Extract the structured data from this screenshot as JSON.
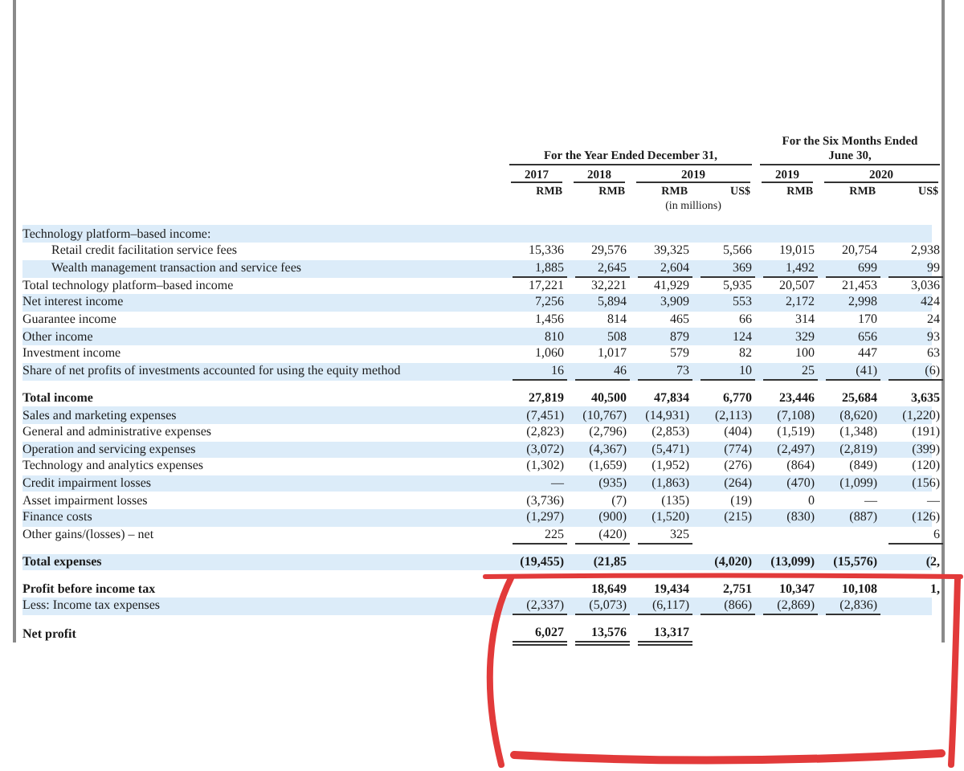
{
  "periods": [
    {
      "title": "For the Year Ended December 31,",
      "years": [
        {
          "label": "2017",
          "units": [
            "RMB"
          ]
        },
        {
          "label": "2018",
          "units": [
            "RMB"
          ]
        },
        {
          "label": "2019",
          "units": [
            "RMB",
            "US$"
          ]
        }
      ]
    },
    {
      "title": "For the Six Months Ended June 30,",
      "years": [
        {
          "label": "2019",
          "units": [
            "RMB"
          ]
        },
        {
          "label": "2020",
          "units": [
            "RMB",
            "US$"
          ]
        }
      ]
    }
  ],
  "note": "(in millions)",
  "rows": [
    {
      "label": "Technology platform–based income:",
      "kind": "section",
      "values": []
    },
    {
      "label": "Retail credit facilitation service fees",
      "kind": "indent",
      "values": [
        "15,336",
        "29,576",
        "39,325",
        "5,566",
        "19,015",
        "20,754",
        "2,938"
      ]
    },
    {
      "label": "Wealth management transaction and service fees",
      "kind": "indent",
      "underlined": true,
      "values": [
        "1,885",
        "2,645",
        "2,604",
        "369",
        "1,492",
        "699",
        "99"
      ]
    },
    {
      "label": "Total technology platform–based income",
      "kind": "item",
      "values": [
        "17,221",
        "32,221",
        "41,929",
        "5,935",
        "20,507",
        "21,453",
        "3,036"
      ]
    },
    {
      "label": "Net interest income",
      "kind": "item",
      "values": [
        "7,256",
        "5,894",
        "3,909",
        "553",
        "2,172",
        "2,998",
        "424"
      ]
    },
    {
      "label": "Guarantee income",
      "kind": "item",
      "values": [
        "1,456",
        "814",
        "465",
        "66",
        "314",
        "170",
        "24"
      ]
    },
    {
      "label": "Other income",
      "kind": "item",
      "values": [
        "810",
        "508",
        "879",
        "124",
        "329",
        "656",
        "93"
      ]
    },
    {
      "label": "Investment income",
      "kind": "item",
      "values": [
        "1,060",
        "1,017",
        "579",
        "82",
        "100",
        "447",
        "63"
      ]
    },
    {
      "label": "Share of net profits of investments accounted for using the equity method",
      "kind": "item",
      "underlined": true,
      "values": [
        "16",
        "46",
        "73",
        "10",
        "25",
        "(41)",
        "(6)"
      ]
    },
    {
      "label": "Total income",
      "kind": "total",
      "values": [
        "27,819",
        "40,500",
        "47,834",
        "6,770",
        "23,446",
        "25,684",
        "3,635"
      ]
    },
    {
      "label": "Sales and marketing expenses",
      "kind": "item",
      "values": [
        "(7,451)",
        "(10,767)",
        "(14,931)",
        "(2,113)",
        "(7,108)",
        "(8,620)",
        "(1,220)"
      ]
    },
    {
      "label": "General and administrative expenses",
      "kind": "item",
      "values": [
        "(2,823)",
        "(2,796)",
        "(2,853)",
        "(404)",
        "(1,519)",
        "(1,348)",
        "(191)"
      ]
    },
    {
      "label": "Operation and servicing expenses",
      "kind": "item",
      "values": [
        "(3,072)",
        "(4,367)",
        "(5,471)",
        "(774)",
        "(2,497)",
        "(2,819)",
        "(399)"
      ]
    },
    {
      "label": "Technology and analytics expenses",
      "kind": "item",
      "values": [
        "(1,302)",
        "(1,659)",
        "(1,952)",
        "(276)",
        "(864)",
        "(849)",
        "(120)"
      ]
    },
    {
      "label": "Credit impairment losses",
      "kind": "item",
      "values": [
        "—",
        "(935)",
        "(1,863)",
        "(264)",
        "(470)",
        "(1,099)",
        "(156)"
      ]
    },
    {
      "label": "Asset impairment losses",
      "kind": "item",
      "values": [
        "(3,736)",
        "(7)",
        "(135)",
        "(19)",
        "0",
        "—",
        "—"
      ]
    },
    {
      "label": "Finance costs",
      "kind": "item",
      "values": [
        "(1,297)",
        "(900)",
        "(1,520)",
        "(215)",
        "(830)",
        "(887)",
        "(126)"
      ]
    },
    {
      "label": "Other gains/(losses) – net",
      "kind": "item",
      "underlined": true,
      "values": [
        "225",
        "(420)",
        "325",
        {
          "kind": "covered"
        },
        {
          "kind": "covered"
        },
        {
          "kind": "covered"
        },
        "6"
      ]
    },
    {
      "label": "Total expenses",
      "kind": "total",
      "values": [
        "(19,455)",
        "(21,85",
        {
          "kind": "covered"
        },
        "(4,020)",
        "(13,099)",
        "(15,576)",
        "(2,"
      ]
    },
    {
      "label": "Profit before income tax",
      "kind": "total",
      "values": [
        {
          "kind": "covered"
        },
        "18,649",
        "19,434",
        "2,751",
        "10,347",
        "10,108",
        "1,"
      ]
    },
    {
      "label": "Less: Income tax expenses",
      "kind": "item",
      "underlined": true,
      "values": [
        "(2,337)",
        "(5,073)",
        "(6,117)",
        "(866)",
        "(2,869)",
        "(2,836)",
        {
          "kind": "covered"
        }
      ]
    },
    {
      "label": "Net profit",
      "kind": "total",
      "double_underlined": true,
      "values": [
        "6,027",
        "13,576",
        "13,317"
      ]
    }
  ]
}
